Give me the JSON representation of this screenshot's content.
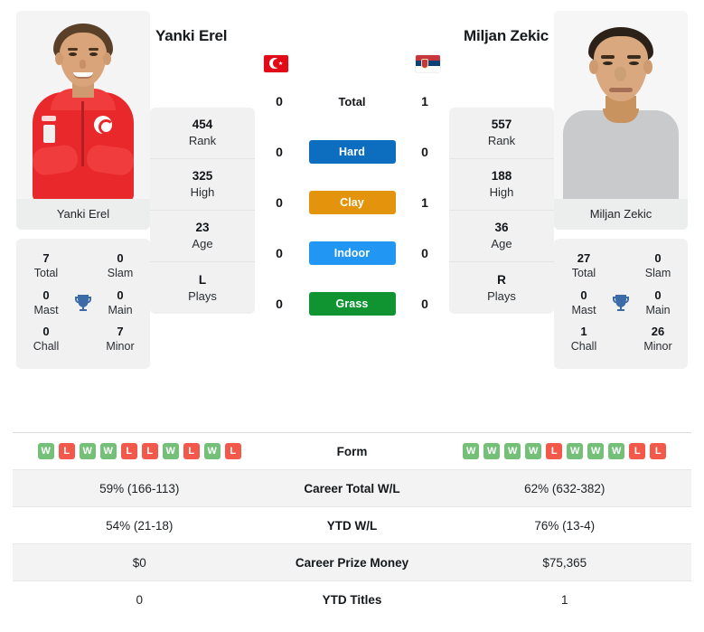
{
  "players": {
    "left": {
      "name": "Yanki Erel",
      "photo_caption": "Yanki Erel",
      "flag": "turkey-flag",
      "career": {
        "total": {
          "value": "7",
          "label": "Total"
        },
        "slam": {
          "value": "0",
          "label": "Slam"
        },
        "mast": {
          "value": "0",
          "label": "Mast"
        },
        "main": {
          "value": "0",
          "label": "Main"
        },
        "chall": {
          "value": "0",
          "label": "Chall"
        },
        "minor": {
          "value": "7",
          "label": "Minor"
        }
      },
      "stats": [
        {
          "value": "454",
          "label": "Rank"
        },
        {
          "value": "325",
          "label": "High"
        },
        {
          "value": "23",
          "label": "Age"
        },
        {
          "value": "L",
          "label": "Plays"
        }
      ],
      "surface_counts": {
        "total": "0",
        "hard": "0",
        "clay": "0",
        "indoor": "0",
        "grass": "0"
      },
      "form": [
        "W",
        "L",
        "W",
        "W",
        "L",
        "L",
        "W",
        "L",
        "W",
        "L"
      ],
      "career_total_wl": "59% (166-113)",
      "ytd_wl": "54% (21-18)",
      "career_prize_money": "$0",
      "ytd_titles": "0"
    },
    "right": {
      "name": "Miljan Zekic",
      "photo_caption": "Miljan Zekic",
      "flag": "serbia-flag",
      "career": {
        "total": {
          "value": "27",
          "label": "Total"
        },
        "slam": {
          "value": "0",
          "label": "Slam"
        },
        "mast": {
          "value": "0",
          "label": "Mast"
        },
        "main": {
          "value": "0",
          "label": "Main"
        },
        "chall": {
          "value": "1",
          "label": "Chall"
        },
        "minor": {
          "value": "26",
          "label": "Minor"
        }
      },
      "stats": [
        {
          "value": "557",
          "label": "Rank"
        },
        {
          "value": "188",
          "label": "High"
        },
        {
          "value": "36",
          "label": "Age"
        },
        {
          "value": "R",
          "label": "Plays"
        }
      ],
      "surface_counts": {
        "total": "1",
        "hard": "0",
        "clay": "1",
        "indoor": "0",
        "grass": "0"
      },
      "form": [
        "W",
        "W",
        "W",
        "W",
        "L",
        "W",
        "W",
        "W",
        "L",
        "L"
      ],
      "career_total_wl": "62% (632-382)",
      "ytd_wl": "76% (13-4)",
      "career_prize_money": "$75,365",
      "ytd_titles": "1"
    }
  },
  "surfaces": [
    {
      "key": "total",
      "label": "Total",
      "color": "",
      "is_pill": false
    },
    {
      "key": "hard",
      "label": "Hard",
      "color": "#0d6ec0",
      "is_pill": true
    },
    {
      "key": "clay",
      "label": "Clay",
      "color": "#e3930c",
      "is_pill": true
    },
    {
      "key": "indoor",
      "label": "Indoor",
      "color": "#2196f3",
      "is_pill": true
    },
    {
      "key": "grass",
      "label": "Grass",
      "color": "#109432",
      "is_pill": true
    }
  ],
  "table_rows": [
    {
      "label": "Form",
      "type": "form"
    },
    {
      "label": "Career Total W/L",
      "type": "text",
      "key": "career_total_wl"
    },
    {
      "label": "YTD W/L",
      "type": "text",
      "key": "ytd_wl"
    },
    {
      "label": "Career Prize Money",
      "type": "text",
      "key": "career_prize_money"
    },
    {
      "label": "YTD Titles",
      "type": "text",
      "key": "ytd_titles"
    }
  ],
  "colors": {
    "win_badge": "#75c078",
    "loss_badge": "#f2594b",
    "trophy": "#3b6ca8",
    "card_bg": "#f1f1f1",
    "row_shade": "#f3f3f3"
  }
}
